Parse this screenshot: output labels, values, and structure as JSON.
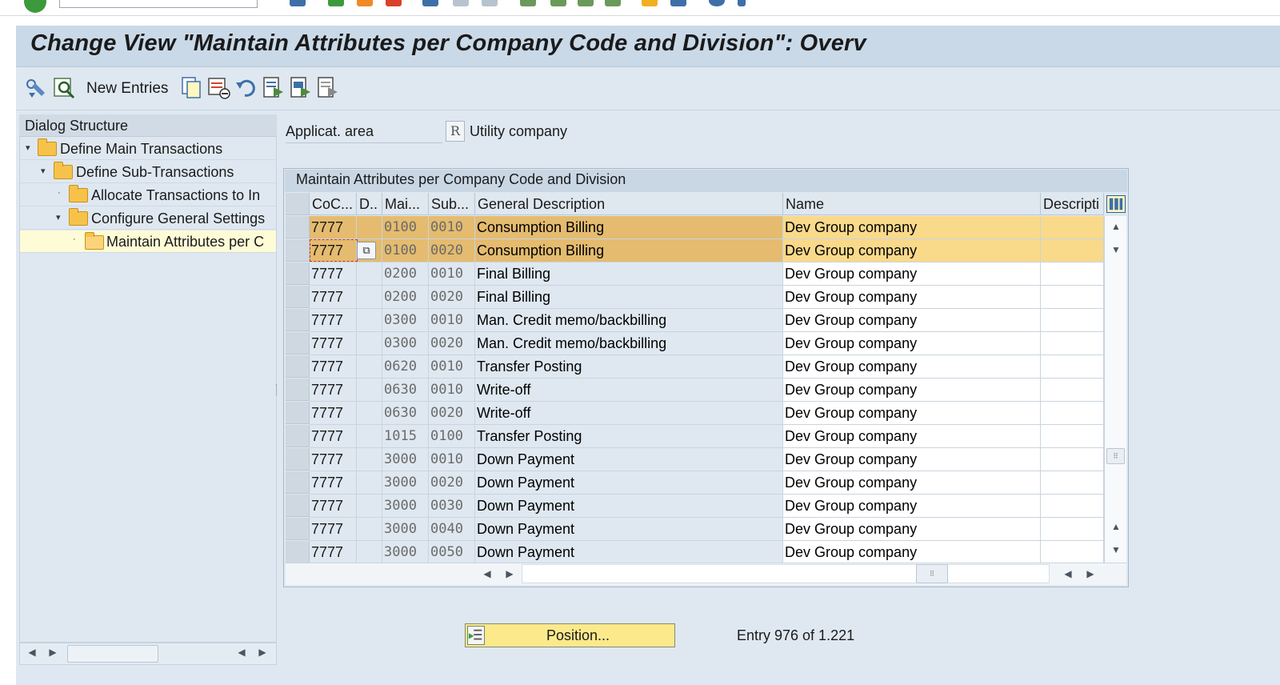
{
  "window": {
    "title": "Change View \"Maintain Attributes per Company Code and Division\": Overv"
  },
  "toolbar": {
    "new_entries_label": "New Entries",
    "icons": [
      "display-change-icon",
      "find-icon",
      "copy-icon",
      "delete-icon",
      "undo-icon",
      "select-all-icon",
      "select-block-icon",
      "deselect-all-icon"
    ]
  },
  "dialog_structure": {
    "title": "Dialog Structure",
    "items": [
      {
        "label": "Define Main Transactions",
        "level": 0,
        "expanded": true
      },
      {
        "label": "Define Sub-Transactions",
        "level": 1,
        "expanded": true
      },
      {
        "label": "Allocate Transactions to In",
        "level": 2,
        "expanded": false
      },
      {
        "label": "Configure General Settings",
        "level": 2,
        "expanded": true
      },
      {
        "label": "Maintain Attributes per C",
        "level": 3,
        "selected": true
      }
    ]
  },
  "application_area": {
    "label": "Applicat. area",
    "value": "R",
    "description": "Utility company"
  },
  "table": {
    "caption": "Maintain Attributes per Company Code and Division",
    "columns": [
      "CoC...",
      "D..",
      "Mai...",
      "Sub...",
      "General Description",
      "Name",
      "Descripti"
    ],
    "rows": [
      {
        "coc": "7777",
        "div": "",
        "main": "0100",
        "sub": "0010",
        "desc": "Consumption Billing",
        "name": "Dev Group company",
        "descr2": "",
        "selected": true
      },
      {
        "coc": "7777",
        "div": "",
        "main": "0100",
        "sub": "0020",
        "desc": "Consumption Billing",
        "name": "Dev Group company",
        "descr2": "",
        "selected": true
      },
      {
        "coc": "7777",
        "div": "",
        "main": "0200",
        "sub": "0010",
        "desc": "Final Billing",
        "name": "Dev Group company",
        "descr2": ""
      },
      {
        "coc": "7777",
        "div": "",
        "main": "0200",
        "sub": "0020",
        "desc": "Final Billing",
        "name": "Dev Group company",
        "descr2": ""
      },
      {
        "coc": "7777",
        "div": "",
        "main": "0300",
        "sub": "0010",
        "desc": "Man. Credit memo/backbilling",
        "name": "Dev Group company",
        "descr2": ""
      },
      {
        "coc": "7777",
        "div": "",
        "main": "0300",
        "sub": "0020",
        "desc": "Man. Credit memo/backbilling",
        "name": "Dev Group company",
        "descr2": ""
      },
      {
        "coc": "7777",
        "div": "",
        "main": "0620",
        "sub": "0010",
        "desc": "Transfer Posting",
        "name": "Dev Group company",
        "descr2": ""
      },
      {
        "coc": "7777",
        "div": "",
        "main": "0630",
        "sub": "0010",
        "desc": "Write-off",
        "name": "Dev Group company",
        "descr2": ""
      },
      {
        "coc": "7777",
        "div": "",
        "main": "0630",
        "sub": "0020",
        "desc": "Write-off",
        "name": "Dev Group company",
        "descr2": ""
      },
      {
        "coc": "7777",
        "div": "",
        "main": "1015",
        "sub": "0100",
        "desc": "Transfer Posting",
        "name": "Dev Group company",
        "descr2": ""
      },
      {
        "coc": "7777",
        "div": "",
        "main": "3000",
        "sub": "0010",
        "desc": "Down Payment",
        "name": "Dev Group company",
        "descr2": ""
      },
      {
        "coc": "7777",
        "div": "",
        "main": "3000",
        "sub": "0020",
        "desc": "Down Payment",
        "name": "Dev Group company",
        "descr2": ""
      },
      {
        "coc": "7777",
        "div": "",
        "main": "3000",
        "sub": "0030",
        "desc": "Down Payment",
        "name": "Dev Group company",
        "descr2": ""
      },
      {
        "coc": "7777",
        "div": "",
        "main": "3000",
        "sub": "0040",
        "desc": "Down Payment",
        "name": "Dev Group company",
        "descr2": ""
      },
      {
        "coc": "7777",
        "div": "",
        "main": "3000",
        "sub": "0050",
        "desc": "Down Payment",
        "name": "Dev Group company",
        "descr2": ""
      }
    ]
  },
  "footer": {
    "position_button_label": "Position...",
    "entry_info": "Entry 976 of 1.221"
  },
  "colors": {
    "selected_key": "#e4bb6f",
    "selected_value": "#f9d98a",
    "title_bar": "#c9d9e8",
    "background": "#dfe8f1",
    "position_button": "#fbe98c"
  }
}
